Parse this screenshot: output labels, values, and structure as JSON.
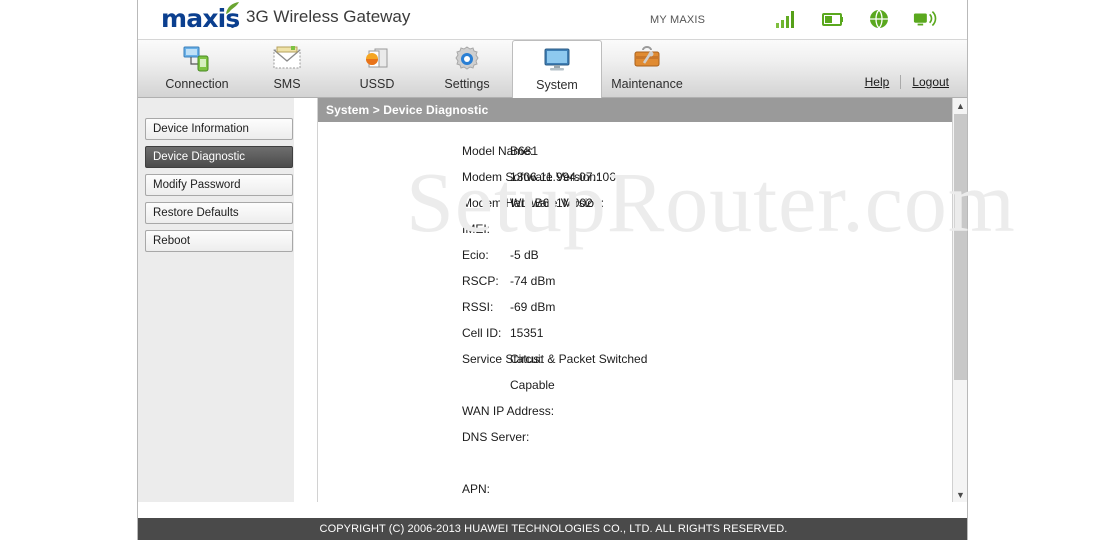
{
  "brand": {
    "logo_text": "maxis",
    "title": "3G Wireless Gateway",
    "account_label": "MY MAXIS",
    "status_icons": [
      {
        "name": "signal-bars-icon",
        "label": "signal strength"
      },
      {
        "name": "battery-icon",
        "label": "battery"
      },
      {
        "name": "globe-icon",
        "label": "internet"
      },
      {
        "name": "wifi-broadcast-icon",
        "label": "wifi broadcast"
      }
    ]
  },
  "nav": {
    "tabs": [
      {
        "label": "Connection",
        "icon": "connection-icon",
        "active": false
      },
      {
        "label": "SMS",
        "icon": "envelope-icon",
        "active": false
      },
      {
        "label": "USSD",
        "icon": "ussd-icon",
        "active": false
      },
      {
        "label": "Settings",
        "icon": "gear-icon",
        "active": false
      },
      {
        "label": "System",
        "icon": "monitor-icon",
        "active": true
      },
      {
        "label": "Maintenance",
        "icon": "toolbox-icon",
        "active": false
      }
    ],
    "help_label": "Help",
    "logout_label": "Logout"
  },
  "sidebar": {
    "items": [
      {
        "label": "Device Information",
        "active": false
      },
      {
        "label": "Device Diagnostic",
        "active": true
      },
      {
        "label": "Modify Password",
        "active": false
      },
      {
        "label": "Restore Defaults",
        "active": false
      },
      {
        "label": "Reboot",
        "active": false
      }
    ]
  },
  "panel": {
    "breadcrumb": "System > Device Diagnostic",
    "rows": [
      {
        "label": "Model Name:",
        "value": "B681"
      },
      {
        "label": "Modem Software Version:",
        "value": "1306.11.994.07.106"
      },
      {
        "label": "Modem Hardware Version:",
        "value": "WL1B681M002"
      },
      {
        "label": "IMEI:",
        "value": ""
      },
      {
        "label": "Ecio:",
        "value": "-5 dB"
      },
      {
        "label": "RSCP:",
        "value": "-74 dBm"
      },
      {
        "label": "RSSI:",
        "value": "-69 dBm"
      },
      {
        "label": "Cell ID:",
        "value": "15351"
      },
      {
        "label": "Service Status:",
        "value": "Circuit & Packet Switched"
      },
      {
        "label": "",
        "value": "Capable",
        "continuation": true
      },
      {
        "label": "WAN IP Address:",
        "value": ""
      },
      {
        "label": "DNS Server:",
        "value": ""
      },
      {
        "label": "",
        "value": "",
        "continuation": true
      },
      {
        "label": "APN:",
        "value": ""
      }
    ]
  },
  "scrollbar": {
    "up_arrow": "▲",
    "down_arrow": "▼"
  },
  "footer": {
    "copyright": "COPYRIGHT (C) 2006-2013 HUAWEI TECHNOLOGIES CO., LTD. ALL RIGHTS RESERVED."
  },
  "watermark": {
    "text": "SetupRouter.com"
  },
  "colors": {
    "brand_blue": "#0b3f8f",
    "panel_header_gray": "#9a9a9a",
    "footer_gray": "#4a4a4a",
    "sidebar_gray": "#ececec",
    "status_green": "#5aa81e"
  }
}
